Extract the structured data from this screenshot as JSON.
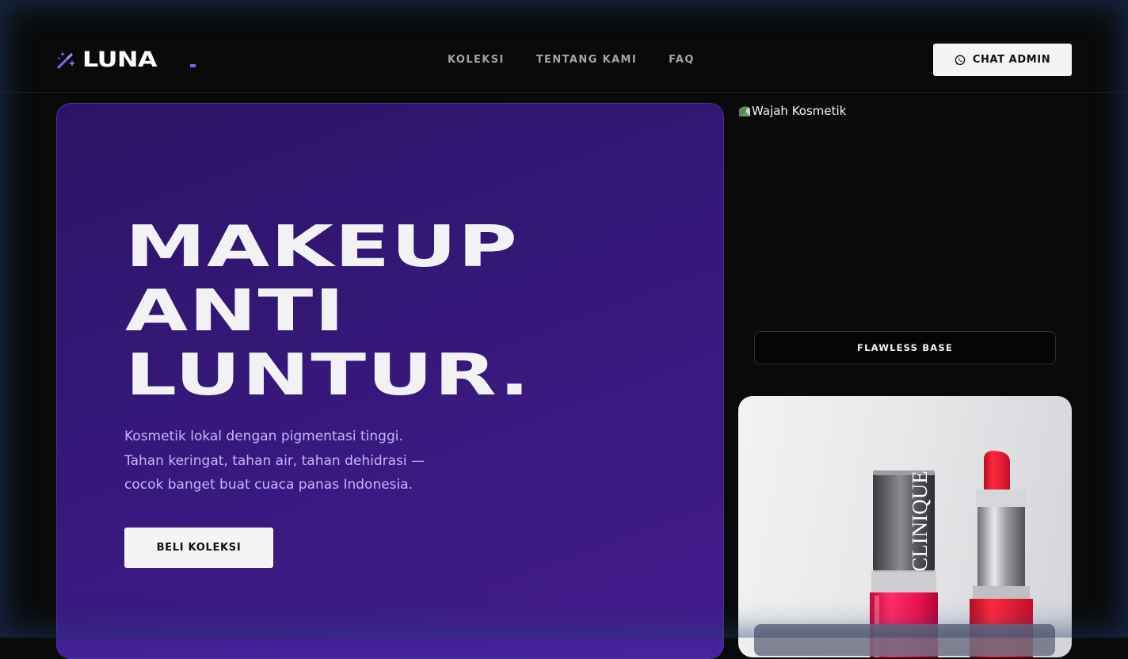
{
  "brand": {
    "name": "LUNA",
    "dot": ".",
    "icon": "magic-wand-sparkle-icon",
    "accent_color": "#8b5cf6"
  },
  "nav": {
    "items": [
      "KOLEKSI",
      "TENTANG KAMI",
      "FAQ"
    ]
  },
  "header": {
    "chat_button_label": "CHAT ADMIN",
    "chat_icon": "whatsapp-icon"
  },
  "hero": {
    "title_lines": [
      "MAKEUP",
      "ANTI",
      "LUNTUR."
    ],
    "description_lines": [
      "Kosmetik lokal dengan pigmentasi tinggi.",
      "Tahan keringat, tahan air, tahan dehidrasi —",
      "cocok banget buat cuaca panas Indonesia."
    ],
    "cta_label": "BELI KOLEKSI",
    "background_color": "#35187a"
  },
  "side": {
    "face_image_alt": "Wajah Kosmetik",
    "face_label": "FLAWLESS BASE",
    "product_brand_text": "CLINIQUE",
    "product_image_name": "lipstick-and-nail-polish-image"
  }
}
